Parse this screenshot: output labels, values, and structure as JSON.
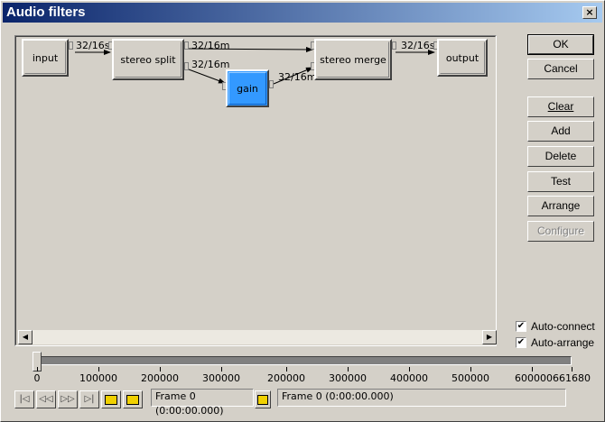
{
  "window": {
    "title": "Audio filters",
    "close_glyph": "×"
  },
  "graph": {
    "nodes": [
      {
        "id": "input",
        "label": "input"
      },
      {
        "id": "stereo_split",
        "label": "stereo split"
      },
      {
        "id": "gain",
        "label": "gain",
        "selected": true
      },
      {
        "id": "stereo_merge",
        "label": "stereo merge"
      },
      {
        "id": "output",
        "label": "output"
      }
    ],
    "connections": [
      {
        "from": "input",
        "to": "stereo_split",
        "label": "32/16s"
      },
      {
        "from": "stereo_split",
        "to": "stereo_merge",
        "label": "32/16m"
      },
      {
        "from": "stereo_split",
        "to": "gain",
        "label": "32/16m"
      },
      {
        "from": "gain",
        "to": "stereo_merge",
        "label": "32/16m"
      },
      {
        "from": "stereo_merge",
        "to": "output",
        "label": "32/16s"
      }
    ],
    "selected_color": "#3399ff"
  },
  "buttons": {
    "ok": "OK",
    "cancel": "Cancel",
    "clear": "Clear",
    "add": "Add",
    "delete": "Delete",
    "test": "Test",
    "arrange": "Arrange",
    "configure": "Configure"
  },
  "options": {
    "auto_connect": {
      "label": "Auto-connect",
      "checked": true
    },
    "auto_arrange": {
      "label": "Auto-arrange",
      "checked": true
    }
  },
  "timeline": {
    "ticks": [
      "0",
      "100000",
      "200000",
      "300000",
      "200000",
      "300000",
      "400000",
      "500000",
      "600000",
      "661680"
    ],
    "position": 0
  },
  "navigation": {
    "frame_current": "Frame 0 (0:00:00.000)",
    "frame_selection": "Frame 0 (0:00:00.000)"
  },
  "scroll_arrows": {
    "left": "◀",
    "right": "▶"
  },
  "nav_glyphs": {
    "start": "|◁",
    "prev_key": "◁◁",
    "next_key": "▷▷",
    "end": "▷|"
  }
}
